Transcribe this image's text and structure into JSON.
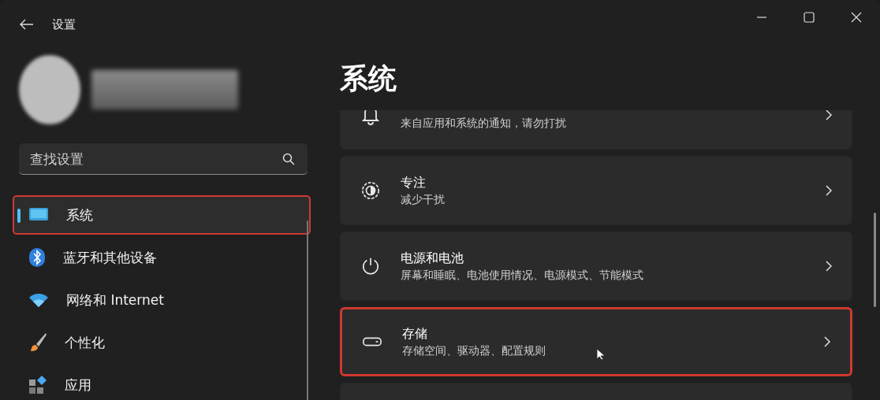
{
  "window": {
    "title": "设置"
  },
  "sidebar": {
    "search": {
      "placeholder": "查找设置"
    },
    "items": [
      {
        "label": "系统",
        "kind": "system",
        "selected": true,
        "highlighted": true
      },
      {
        "label": "蓝牙和其他设备",
        "kind": "bluetooth",
        "selected": false,
        "highlighted": false
      },
      {
        "label": "网络和 Internet",
        "kind": "wifi",
        "selected": false,
        "highlighted": false
      },
      {
        "label": "个性化",
        "kind": "brush",
        "selected": false,
        "highlighted": false
      },
      {
        "label": "应用",
        "kind": "apps",
        "selected": false,
        "highlighted": false
      }
    ]
  },
  "main": {
    "heading": "系统",
    "cards": [
      {
        "kind": "bell",
        "subtitle": "来自应用和系统的通知，请勿打扰",
        "highlighted": false
      },
      {
        "kind": "focus",
        "title": "专注",
        "subtitle": "减少干扰",
        "highlighted": false
      },
      {
        "kind": "power",
        "title": "电源和电池",
        "subtitle": "屏幕和睡眠、电池使用情况、电源模式、节能模式",
        "highlighted": false
      },
      {
        "kind": "storage",
        "title": "存储",
        "subtitle": "存储空间、驱动器、配置规则",
        "highlighted": true
      },
      {
        "highlighted": false
      }
    ]
  }
}
